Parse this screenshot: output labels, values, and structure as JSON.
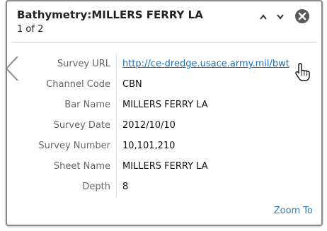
{
  "popup": {
    "title": "Bathymetry:MILLERS FERRY LA",
    "counter": "1 of 2",
    "zoom_label": "Zoom To",
    "attributes": [
      {
        "label": "Survey URL",
        "value": "http://ce-dredge.usace.army.mil/bwt",
        "is_link": true
      },
      {
        "label": "Channel Code",
        "value": "CBN"
      },
      {
        "label": "Bar Name",
        "value": "MILLERS FERRY LA"
      },
      {
        "label": "Survey Date",
        "value": "2012/10/10"
      },
      {
        "label": "Survey Number",
        "value": "10,101,210"
      },
      {
        "label": "Sheet Name",
        "value": "MILLERS FERRY LA"
      },
      {
        "label": "Depth",
        "value": "8"
      }
    ]
  },
  "icons": {
    "prev": "chevron-up-icon",
    "next": "chevron-down-icon",
    "close": "close-circle-icon",
    "cursor": "hand-pointer-icon"
  },
  "colors": {
    "link": "#1a6fba",
    "label_text": "#666666",
    "border": "#8a8a8a"
  }
}
